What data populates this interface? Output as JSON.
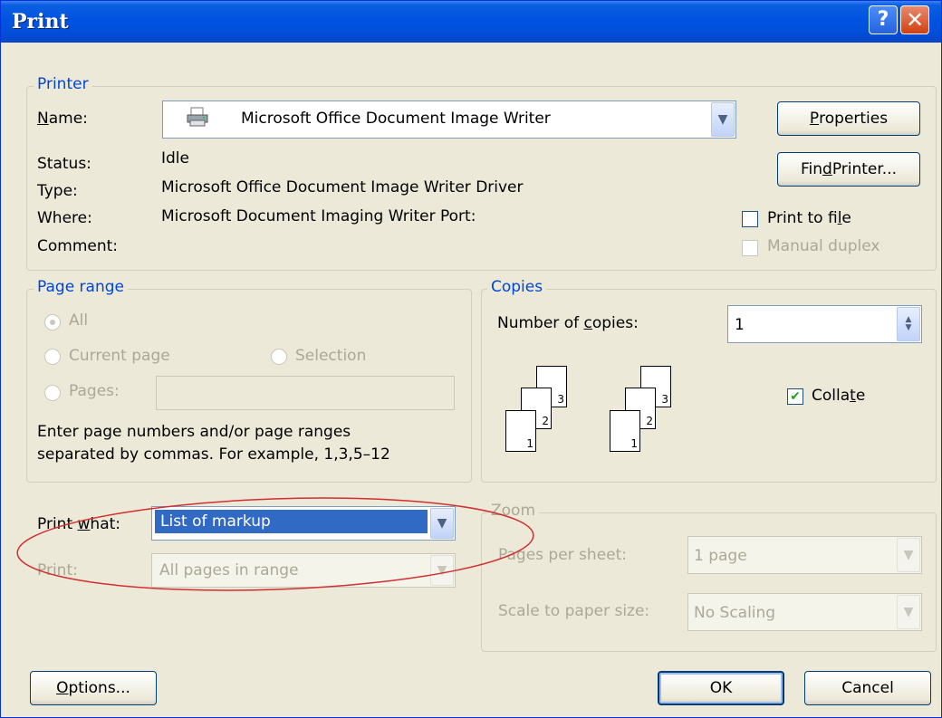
{
  "window": {
    "title": "Print",
    "help_glyph": "?",
    "close_glyph": "✕"
  },
  "printer": {
    "legend": "Printer",
    "name_label_pre": "",
    "name_label_u": "N",
    "name_label_post": "ame:",
    "name_value": "Microsoft Office Document Image Writer",
    "status_label": "Status:",
    "status_value": "Idle",
    "type_label": "Type:",
    "type_value": "Microsoft Office Document Image Writer Driver",
    "where_label": "Where:",
    "where_value": "Microsoft Document Imaging Writer Port:",
    "comment_label": "Comment:",
    "properties_u": "P",
    "properties_post": "roperties",
    "find_pre": "Fin",
    "find_u": "d",
    "find_post": " Printer...",
    "print_to_file_pre": "Print to fi",
    "print_to_file_u": "l",
    "print_to_file_post": "e",
    "print_to_file_checked": false,
    "manual_duplex": "Manual duplex",
    "manual_duplex_checked": false
  },
  "page_range": {
    "legend": "Page range",
    "all": "All",
    "current_page": "Current page",
    "selection": "Selection",
    "pages": "Pages:",
    "pages_value": "",
    "help_line1": "Enter page numbers and/or page ranges",
    "help_line2": "separated by commas.  For example, 1,3,5–12",
    "selected": "All"
  },
  "copies": {
    "legend": "Copies",
    "number_pre": "Number of ",
    "number_u": "c",
    "number_post": "opies:",
    "number_value": "1",
    "collate_pre": "Colla",
    "collate_u": "t",
    "collate_post": "e",
    "collate_checked": true,
    "page_numbers": [
      "3",
      "2",
      "1"
    ]
  },
  "print_what": {
    "label_pre": "Print ",
    "label_u": "w",
    "label_post": "hat:",
    "value": "List of markup",
    "print_label": "Print:",
    "print_value": "All pages in range"
  },
  "zoom": {
    "legend": "Zoom",
    "pages_per_sheet_label": "Pages per sheet:",
    "pages_per_sheet_value": "1 page",
    "scale_label": "Scale to paper size:",
    "scale_value": "No Scaling"
  },
  "buttons": {
    "options_u": "O",
    "options_post": "ptions...",
    "ok": "OK",
    "cancel": "Cancel"
  },
  "colors": {
    "title_bar": "#0053e1",
    "legend_text": "#0046d5",
    "annotation": "#d03030",
    "selection": "#316ac5"
  },
  "icons": {
    "printer": "printer-icon",
    "dropdown": "chevron-down-icon",
    "spinner": "spinner-arrows-icon",
    "check": "checkmark-icon"
  }
}
